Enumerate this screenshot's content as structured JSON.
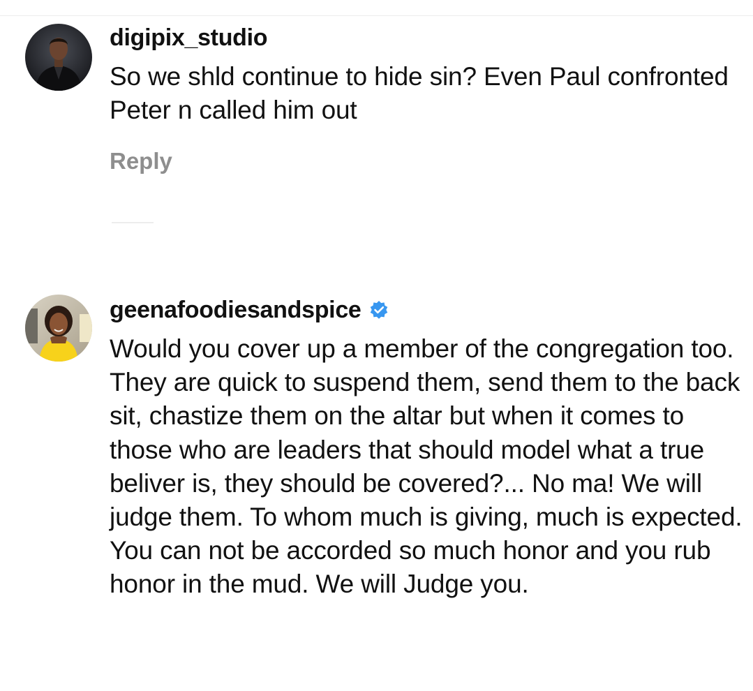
{
  "comments": [
    {
      "username": "digipix_studio",
      "verified": false,
      "text": "So we shld continue to hide sin? Even Paul confronted Peter n called him out",
      "reply_label": "Reply"
    },
    {
      "username": "geenafoodiesandspice",
      "verified": true,
      "text": "Would you cover up a member of the congregation too. They are quick to suspend them, send them to the back sit, chastize them on the altar but when it comes to those who are leaders that should model what a true beliver is, they should be covered?... No ma! We will judge them. To whom much is giving, much is expected. You can not be accorded so much honor and you rub honor in the mud. We will Judge you."
    }
  ],
  "colors": {
    "text": "#111111",
    "secondary": "#8e8e8e",
    "verified_blue": "#3897f0"
  },
  "icons": {
    "verified": "verified-badge-icon"
  }
}
